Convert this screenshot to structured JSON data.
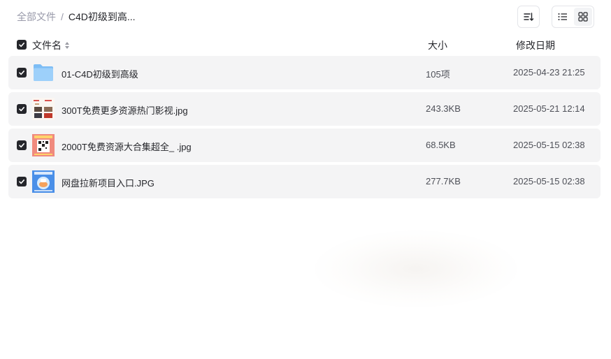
{
  "breadcrumb": {
    "root": "全部文件",
    "separator": "/",
    "current": "C4D初级到高..."
  },
  "toolbar": {
    "sort_icon": "sort-icon",
    "list_icon": "list-view-icon",
    "grid_icon": "grid-view-icon"
  },
  "table": {
    "col_name": "文件名",
    "col_size": "大小",
    "col_date": "修改日期"
  },
  "files": [
    {
      "name": "01-C4D初级到高级",
      "size": "105项",
      "date": "2025-04-23 21:25",
      "type": "folder"
    },
    {
      "name": "300T免费更多资源热门影视.jpg",
      "size": "243.3KB",
      "date": "2025-05-21 12:14",
      "type": "image"
    },
    {
      "name": "2000T免费资源大合集超全_ .jpg",
      "size": "68.5KB",
      "date": "2025-05-15 02:38",
      "type": "image"
    },
    {
      "name": "网盘拉新项目入口.JPG",
      "size": "277.7KB",
      "date": "2025-05-15 02:38",
      "type": "image"
    }
  ],
  "colors": {
    "checkbox": "#25262b",
    "row_bg": "#f4f4f5",
    "folder": "#8cc6f7",
    "muted_text": "#999aaa"
  }
}
